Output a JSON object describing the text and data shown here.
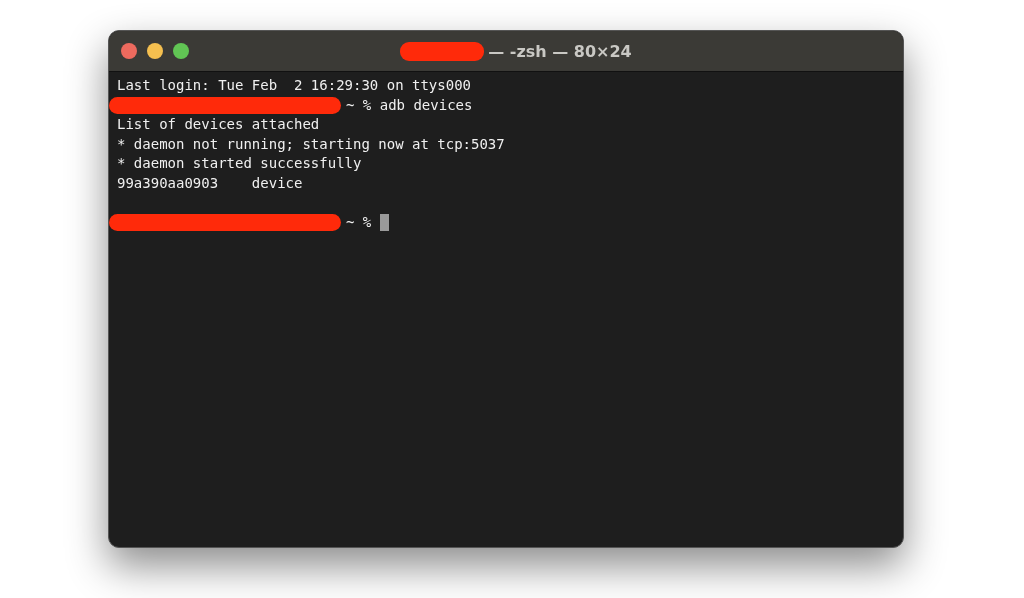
{
  "window": {
    "title": "— -zsh — 80×24",
    "title_redacted": true
  },
  "lines": [
    {
      "kind": "output",
      "text": "Last login: Tue Feb  2 16:29:30 on ttys000"
    },
    {
      "kind": "prompt",
      "redacted": true,
      "text": "~ % adb devices",
      "cursor": false
    },
    {
      "kind": "output",
      "text": "List of devices attached"
    },
    {
      "kind": "output",
      "text": "* daemon not running; starting now at tcp:5037"
    },
    {
      "kind": "output",
      "text": "* daemon started successfully"
    },
    {
      "kind": "output",
      "text": "99a390aa0903    device"
    },
    {
      "kind": "blank"
    },
    {
      "kind": "prompt",
      "redacted": true,
      "text": "~ %",
      "cursor": true
    }
  ]
}
